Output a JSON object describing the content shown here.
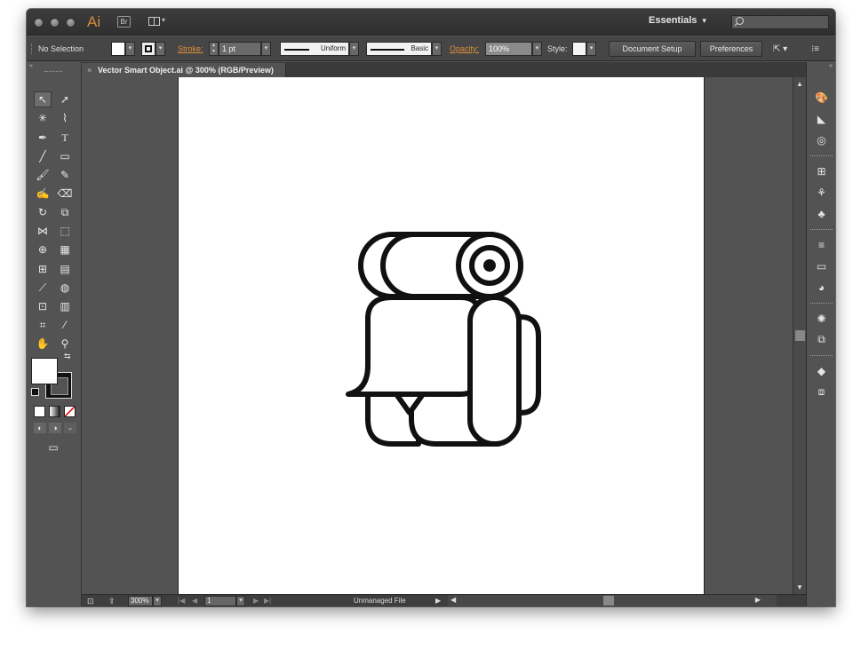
{
  "app": {
    "logo_text": "Ai",
    "bridge_label": "Br",
    "workspace_label": "Essentials",
    "workspace_caret": "▾",
    "search_placeholder": ""
  },
  "control_bar": {
    "selection_label": "No Selection",
    "stroke_label": "Stroke:",
    "stroke_weight": "1 pt",
    "variable_width_profile": "Uniform",
    "brush_definition": "Basic",
    "opacity_label": "Opacity:",
    "opacity_value": "100%",
    "style_label": "Style:",
    "document_setup_label": "Document Setup",
    "preferences_label": "Preferences"
  },
  "document": {
    "tab_title": "Vector Smart Object.ai @ 300% (RGB/Preview)",
    "close_glyph": "×"
  },
  "status_bar": {
    "zoom_value": "300%",
    "artboard_number": "1",
    "status_text": "Unmanaged File"
  },
  "artwork": {
    "stroke_color": "#111111",
    "fill_color": "#ffffff",
    "subject": "backpack-icon"
  },
  "colors": {
    "accent": "#e0903a",
    "panel_bg": "#535353",
    "chrome_dark": "#2f2f2f"
  }
}
